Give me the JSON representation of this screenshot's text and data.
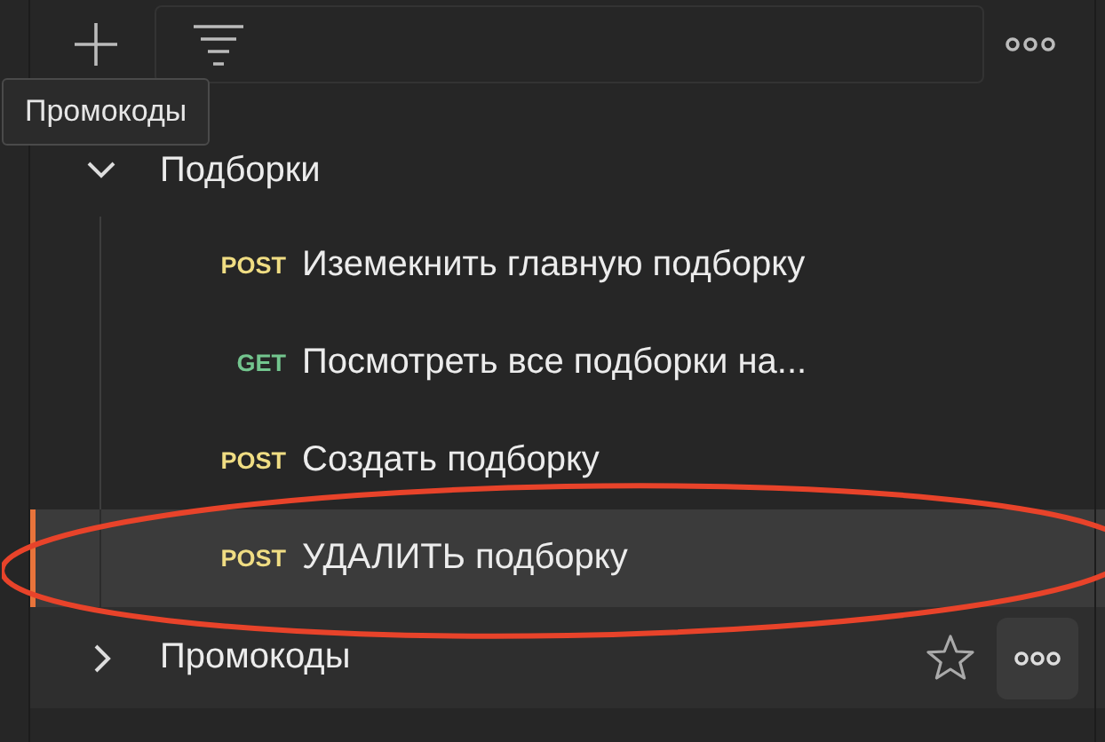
{
  "toolbar": {
    "tooltip": "Промокоды"
  },
  "folders": [
    {
      "name": "Подборки",
      "expanded": true,
      "hovered": false,
      "children": [
        {
          "kind": "post",
          "method": "POST",
          "name": "Иземекнить главную подборку",
          "selected": false
        },
        {
          "kind": "get",
          "method": "GET",
          "name": "Посмотреть все подборки на...",
          "selected": false
        },
        {
          "kind": "post",
          "method": "POST",
          "name": "Создать подборку",
          "selected": false
        },
        {
          "kind": "post",
          "method": "POST",
          "name": "УДАЛИТЬ подборку",
          "selected": true
        }
      ]
    },
    {
      "name": "Промокоды",
      "expanded": false,
      "hovered": true
    }
  ],
  "annotation": {
    "kind": "ellipse"
  }
}
